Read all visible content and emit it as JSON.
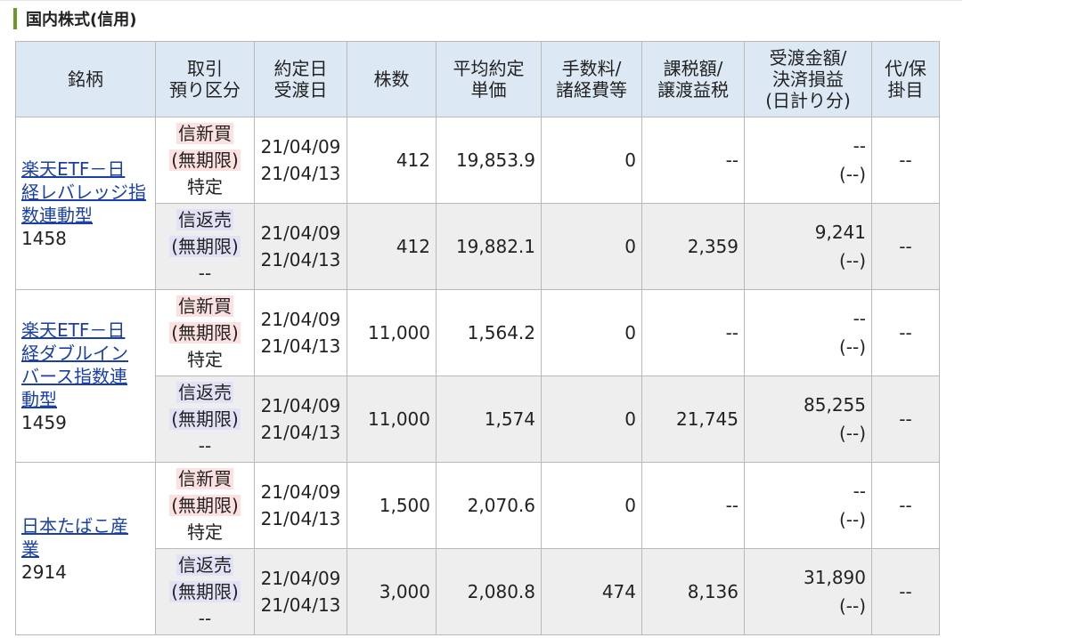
{
  "section": {
    "title": "国内株式(信用)"
  },
  "columns": [
    {
      "line1": "銘柄",
      "line2": "",
      "line3": ""
    },
    {
      "line1": "取引",
      "line2": "預り区分",
      "line3": ""
    },
    {
      "line1": "約定日",
      "line2": "受渡日",
      "line3": ""
    },
    {
      "line1": "株数",
      "line2": "",
      "line3": ""
    },
    {
      "line1": "平均約定",
      "line2": "単価",
      "line3": ""
    },
    {
      "line1": "手数料/",
      "line2": "諸経費等",
      "line3": ""
    },
    {
      "line1": "課税額/",
      "line2": "譲渡益税",
      "line3": ""
    },
    {
      "line1": "受渡金額/",
      "line2": "決済損益",
      "line3": "(日計り分)"
    },
    {
      "line1": "代/保",
      "line2": "掛目",
      "line3": ""
    }
  ],
  "stocks": [
    {
      "name_lines": [
        "楽天ETF－日",
        "経レバレッジ指",
        "数連動型"
      ],
      "code": "1458",
      "rows": [
        {
          "trade": "信新買",
          "term": "(無期限)",
          "account": "特定",
          "trade_date": "21/04/09",
          "settle_date": "21/04/13",
          "shares": "412",
          "avg_price": "19,853.9",
          "fee": "0",
          "tax": "--",
          "amount": "--",
          "pl": "(--)",
          "margin": "--"
        },
        {
          "trade": "信返売",
          "term": "(無期限)",
          "account": "--",
          "trade_date": "21/04/09",
          "settle_date": "21/04/13",
          "shares": "412",
          "avg_price": "19,882.1",
          "fee": "0",
          "tax": "2,359",
          "amount": "9,241",
          "pl": "(--)",
          "margin": "--"
        }
      ]
    },
    {
      "name_lines": [
        "楽天ETF－日",
        "経ダブルイン",
        "バース指数連",
        "動型"
      ],
      "code": "1459",
      "rows": [
        {
          "trade": "信新買",
          "term": "(無期限)",
          "account": "特定",
          "trade_date": "21/04/09",
          "settle_date": "21/04/13",
          "shares": "11,000",
          "avg_price": "1,564.2",
          "fee": "0",
          "tax": "--",
          "amount": "--",
          "pl": "(--)",
          "margin": "--"
        },
        {
          "trade": "信返売",
          "term": "(無期限)",
          "account": "--",
          "trade_date": "21/04/09",
          "settle_date": "21/04/13",
          "shares": "11,000",
          "avg_price": "1,574",
          "fee": "0",
          "tax": "21,745",
          "amount": "85,255",
          "pl": "(--)",
          "margin": "--"
        }
      ]
    },
    {
      "name_lines": [
        "日本たばこ産",
        "業"
      ],
      "code": "2914",
      "rows": [
        {
          "trade": "信新買",
          "term": "(無期限)",
          "account": "特定",
          "trade_date": "21/04/09",
          "settle_date": "21/04/13",
          "shares": "1,500",
          "avg_price": "2,070.6",
          "fee": "0",
          "tax": "--",
          "amount": "--",
          "pl": "(--)",
          "margin": "--"
        },
        {
          "trade": "信返売",
          "term": "(無期限)",
          "account": "--",
          "trade_date": "21/04/09",
          "settle_date": "21/04/13",
          "shares": "3,000",
          "avg_price": "2,080.8",
          "fee": "474",
          "tax": "8,136",
          "amount": "31,890",
          "pl": "(--)",
          "margin": "--"
        }
      ]
    }
  ],
  "colors": {
    "header_bg": "#dce8f3",
    "accent_bar": "#6b9a2a",
    "buy_bg": "#fde0e0",
    "sell_bg": "#e2e2f7",
    "link": "#1a3fa8"
  }
}
